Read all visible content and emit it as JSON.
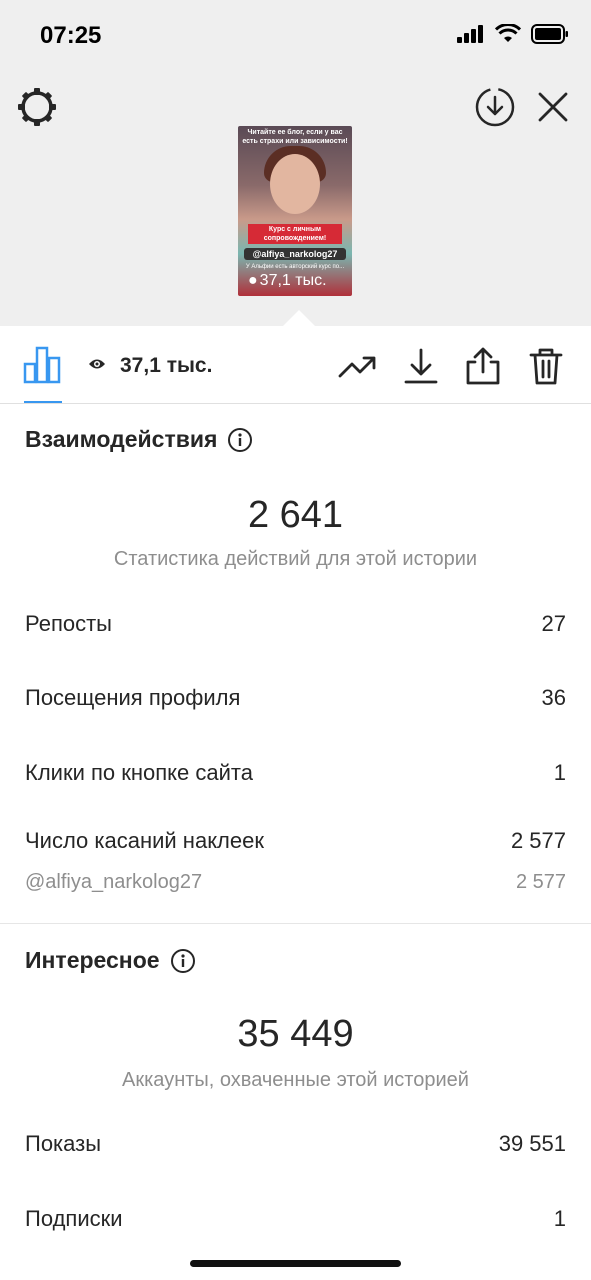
{
  "status": {
    "time": "07:25"
  },
  "thumbnail": {
    "caption_top": "Читайте ее блог, если у вас есть страхи или зависимости!",
    "caption_middle": "Курс с личным сопровождением!",
    "mention": "@alfiya_narkolog27",
    "caption_bottom": "У Альфии есть авторский курс по...",
    "views": "37,1 тыс."
  },
  "tabbar": {
    "views": "37,1 тыс."
  },
  "interactions": {
    "title": "Взаимодействия",
    "total": "2 641",
    "caption": "Статистика действий для этой истории",
    "rows": [
      {
        "label": "Репосты",
        "value": "27"
      },
      {
        "label": "Посещения профиля",
        "value": "36"
      },
      {
        "label": "Клики по кнопке сайта",
        "value": "1"
      },
      {
        "label": "Число касаний наклеек",
        "value": "2 577"
      }
    ],
    "sticker": {
      "label": "@alfiya_narkolog27",
      "value": "2 577"
    }
  },
  "discovery": {
    "title": "Интересное",
    "total": "35 449",
    "caption": "Аккаунты, охваченные этой историей",
    "rows": [
      {
        "label": "Показы",
        "value": "39 551"
      },
      {
        "label": "Подписки",
        "value": "1"
      }
    ]
  },
  "icons": {
    "settings": "gear-icon",
    "download_circle": "download-circle-icon",
    "close": "close-icon",
    "insights": "bar-chart-icon",
    "eye": "eye-icon",
    "promote": "trending-up-icon",
    "save": "download-icon",
    "share": "share-icon",
    "delete": "trash-icon",
    "info": "info-icon"
  },
  "colors": {
    "accent": "#3897f0",
    "secondary_text": "#8e8e8e"
  }
}
